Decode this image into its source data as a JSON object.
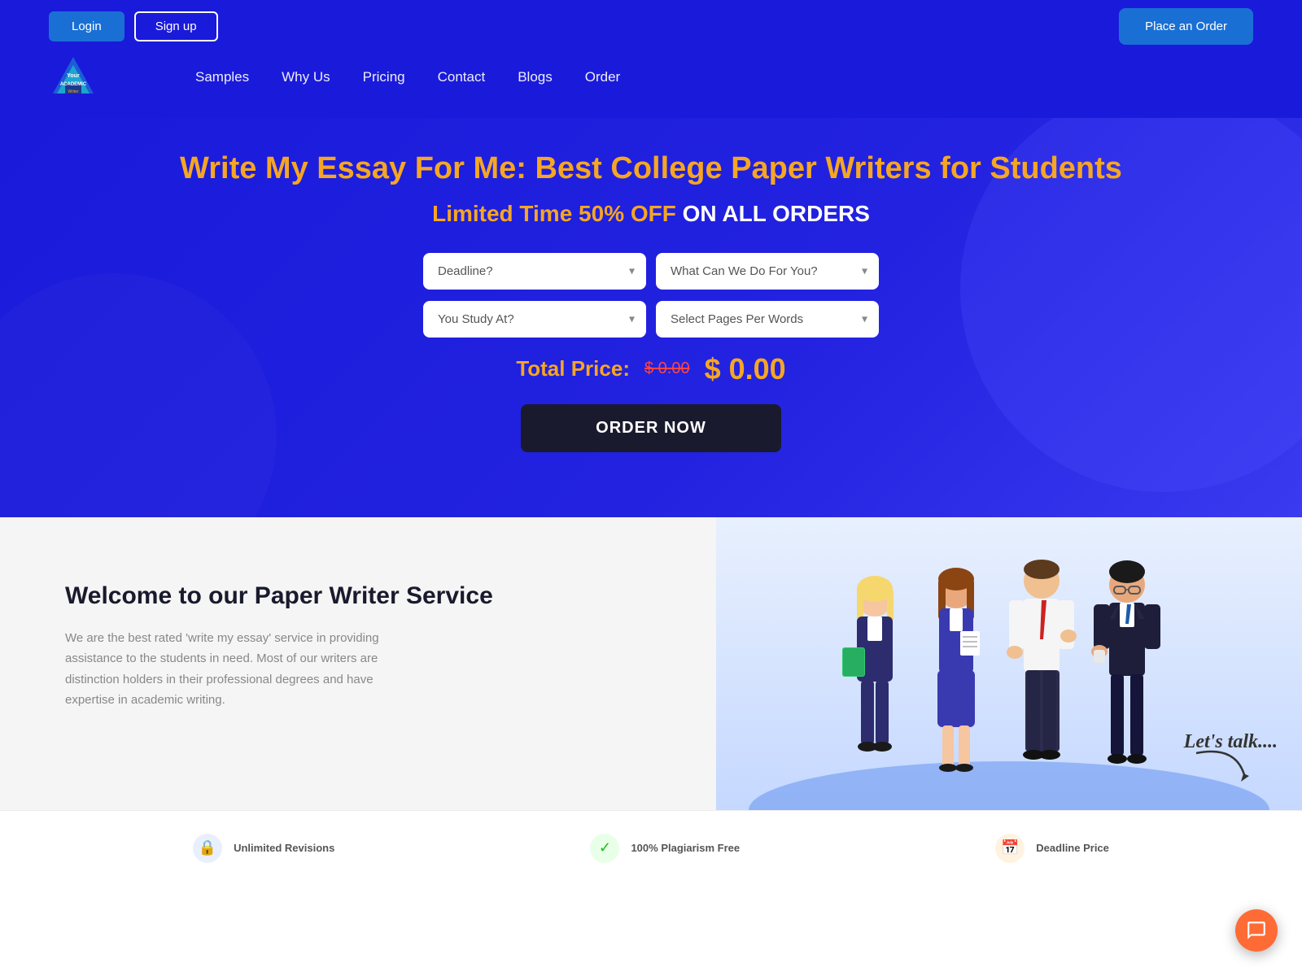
{
  "topbar": {
    "login_label": "Login",
    "signup_label": "Sign up",
    "place_order_label": "Place an Order"
  },
  "nav": {
    "logo_text": "Your\nACADEMIC\nWriter",
    "links": [
      {
        "label": "Samples",
        "href": "#"
      },
      {
        "label": "Why Us",
        "href": "#"
      },
      {
        "label": "Pricing",
        "href": "#"
      },
      {
        "label": "Contact",
        "href": "#"
      },
      {
        "label": "Blogs",
        "href": "#"
      },
      {
        "label": "Order",
        "href": "#"
      }
    ]
  },
  "hero": {
    "title": "Write My Essay For Me: Best College Paper Writers for Students",
    "subtitle_highlight": "Limited Time 50% OFF",
    "subtitle_bold": "ON ALL ORDERS",
    "deadline_placeholder": "Deadline?",
    "what_placeholder": "What Can We Do For You?",
    "study_placeholder": "You Study At?",
    "pages_placeholder": "Select Pages Per Words",
    "price_label": "Total Price:",
    "price_original": "$ 0.00",
    "price_current": "$ 0.00",
    "order_btn": "ORDER NOW"
  },
  "welcome": {
    "title": "Welcome to our Paper Writer Service",
    "description": "We are the best rated 'write my essay' service in providing assistance to the students in need. Most of our writers are distinction holders in their professional degrees and have expertise in academic writing."
  },
  "lets_talk": "Let's talk....",
  "chat": {
    "icon": "💬"
  },
  "stats": [
    {
      "icon": "🔒",
      "color": "blue",
      "label": "Unlimited Revisions"
    },
    {
      "icon": "✓",
      "color": "green",
      "label": "100% Plagiarism Free"
    },
    {
      "icon": "📅",
      "color": "orange",
      "label": "Deadline Price"
    }
  ]
}
